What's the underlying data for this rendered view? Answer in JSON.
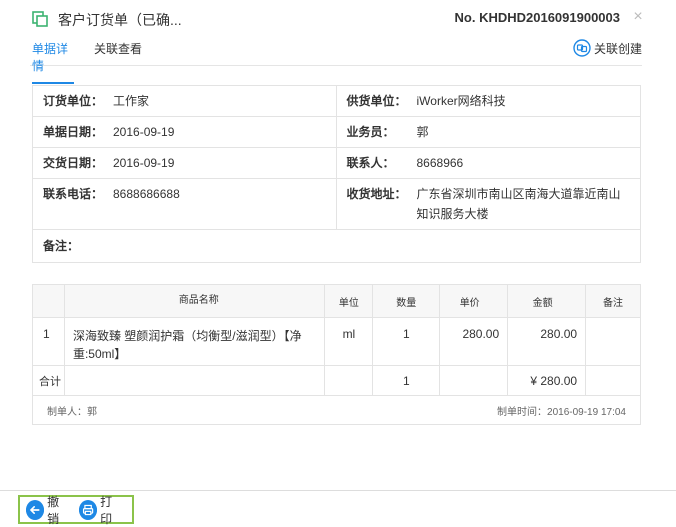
{
  "header": {
    "title": "客户订货单（已确...",
    "doc_no": "No. KHDHD2016091900003",
    "close": "×"
  },
  "tabs": [
    {
      "label": "单据详情",
      "active": true
    },
    {
      "label": "关联查看",
      "active": false
    }
  ],
  "related_create_label": "关联创建",
  "info": {
    "customer_label": "订货单位：",
    "customer": "工作家",
    "supplier_label": "供货单位：",
    "supplier": "iWorker网络科技",
    "doc_date_label": "单据日期：",
    "doc_date": "2016-09-19",
    "salesman_label": "业务员：",
    "salesman": "郭",
    "delivery_date_label": "交货日期：",
    "delivery_date": "2016-09-19",
    "contact_label": "联系人：",
    "contact": "8668966",
    "phone_label": "联系电话：",
    "phone": "8688686688",
    "address_label": "收货地址：",
    "address": "广东省深圳市南山区南海大道靠近南山知识服务大楼",
    "note_label": "备注："
  },
  "goods": {
    "headers": {
      "idx": "",
      "name": "商品名称",
      "unit": "单位",
      "qty": "数量",
      "price": "单价",
      "amount": "金额",
      "note": "备注"
    },
    "rows": [
      {
        "idx": "1",
        "name": "深海致臻 塑颜润护霜（均衡型/滋润型）【净重:50ml】",
        "unit": "ml",
        "qty": "1",
        "price": "280.00",
        "amount": "280.00",
        "note": ""
      }
    ],
    "total": {
      "label": "合计",
      "qty": "1",
      "amount": "¥ 280.00"
    },
    "maker": "制单人：郭",
    "made_time": "制单时间：2016-09-19 17:04"
  },
  "actions": {
    "revoke_label": "撤销",
    "print_label": "打印"
  },
  "colors": {
    "accent": "#1e88e5",
    "highlight_border": "#8bc34a",
    "doc_icon": "#3cb371"
  }
}
